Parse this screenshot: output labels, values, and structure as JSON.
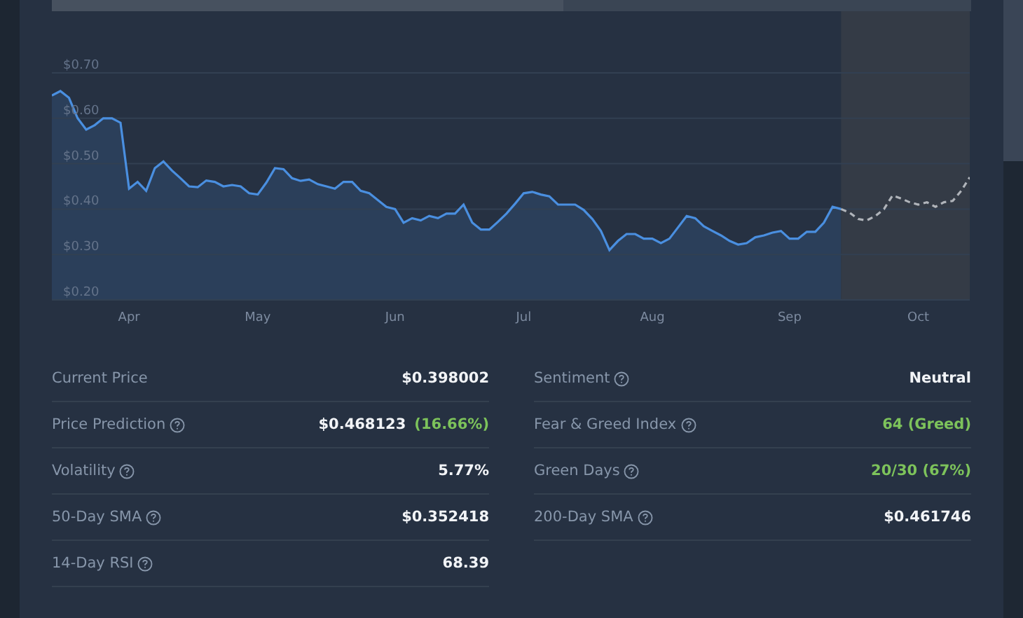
{
  "range_navigator": {
    "level": 0.557
  },
  "chart": {
    "chart_data": {
      "type": "area",
      "ylim": [
        0.2,
        0.7
      ],
      "grid": true,
      "yticks": [
        {
          "value": 0.2,
          "label": "$0.20"
        },
        {
          "value": 0.3,
          "label": "$0.30"
        },
        {
          "value": 0.4,
          "label": "$0.40"
        },
        {
          "value": 0.5,
          "label": "$0.50"
        },
        {
          "value": 0.6,
          "label": "$0.60"
        },
        {
          "value": 0.7,
          "label": "$0.70"
        }
      ],
      "categories": [
        null,
        null,
        null,
        null,
        null,
        null,
        null,
        null,
        null,
        "Apr",
        null,
        null,
        null,
        null,
        null,
        null,
        null,
        null,
        null,
        null,
        null,
        null,
        null,
        null,
        "May",
        null,
        null,
        null,
        null,
        null,
        null,
        null,
        null,
        null,
        null,
        null,
        null,
        null,
        null,
        null,
        "Jun",
        null,
        null,
        null,
        null,
        null,
        null,
        null,
        null,
        null,
        null,
        null,
        null,
        null,
        null,
        "Jul",
        null,
        null,
        null,
        null,
        null,
        null,
        null,
        null,
        null,
        null,
        null,
        null,
        null,
        null,
        "Aug",
        null,
        null,
        null,
        null,
        null,
        null,
        null,
        null,
        null,
        null,
        null,
        null,
        null,
        null,
        null,
        "Sep",
        null,
        null,
        null,
        null,
        null,
        null,
        null,
        null,
        null,
        null,
        null,
        null,
        null,
        null,
        "Oct",
        null,
        null,
        null,
        null,
        null,
        null
      ],
      "series": [
        {
          "color": "#4a8fe0",
          "values": [
            0.65,
            0.66,
            0.645,
            0.6,
            0.575,
            0.585,
            0.6,
            0.6,
            0.59,
            0.445,
            0.46,
            0.44,
            0.49,
            0.505,
            0.485,
            0.468,
            0.45,
            0.448,
            0.463,
            0.46,
            0.45,
            0.453,
            0.45,
            0.435,
            0.432,
            0.458,
            0.49,
            0.488,
            0.468,
            0.462,
            0.465,
            0.455,
            0.45,
            0.445,
            0.46,
            0.46,
            0.44,
            0.435,
            0.42,
            0.405,
            0.4,
            0.37,
            0.38,
            0.375,
            0.385,
            0.38,
            0.39,
            0.39,
            0.41,
            0.37,
            0.355,
            0.355,
            0.372,
            0.39,
            0.412,
            0.435,
            0.438,
            0.432,
            0.428,
            0.41,
            0.41,
            0.41,
            0.398,
            0.378,
            0.352,
            0.31,
            0.33,
            0.345,
            0.345,
            0.335,
            0.335,
            0.325,
            0.335,
            0.36,
            0.385,
            0.38,
            0.362,
            0.352,
            0.342,
            0.33,
            0.322,
            0.325,
            0.338,
            0.342,
            0.348,
            0.352,
            0.335,
            0.335,
            0.35,
            0.35,
            0.37,
            0.405,
            0.4,
            null,
            null,
            null,
            null,
            null,
            null,
            null,
            null,
            null,
            null,
            null,
            null,
            null,
            null,
            null
          ]
        },
        {
          "type": "line",
          "line_style": "dashed",
          "color": "#b0b4ba",
          "values": [
            null,
            null,
            null,
            null,
            null,
            null,
            null,
            null,
            null,
            null,
            null,
            null,
            null,
            null,
            null,
            null,
            null,
            null,
            null,
            null,
            null,
            null,
            null,
            null,
            null,
            null,
            null,
            null,
            null,
            null,
            null,
            null,
            null,
            null,
            null,
            null,
            null,
            null,
            null,
            null,
            null,
            null,
            null,
            null,
            null,
            null,
            null,
            null,
            null,
            null,
            null,
            null,
            null,
            null,
            null,
            null,
            null,
            null,
            null,
            null,
            null,
            null,
            null,
            null,
            null,
            null,
            null,
            null,
            null,
            null,
            null,
            null,
            null,
            null,
            null,
            null,
            null,
            null,
            null,
            null,
            null,
            null,
            null,
            null,
            null,
            null,
            null,
            null,
            null,
            null,
            null,
            null,
            0.4,
            0.392,
            0.378,
            0.375,
            0.385,
            0.4,
            0.43,
            0.423,
            0.415,
            0.41,
            0.415,
            0.405,
            0.415,
            0.418,
            0.44,
            0.47
          ]
        }
      ]
    }
  },
  "stats": [
    [
      {
        "label": "Current Price",
        "help": false,
        "value": [
          {
            "text": "$0.398002",
            "positive": false
          }
        ]
      },
      {
        "label": "Price Prediction",
        "help": true,
        "value": [
          {
            "text": "$0.468123",
            "positive": false
          },
          {
            "text": "(16.66%)",
            "positive": true
          }
        ]
      },
      {
        "label": "Volatility",
        "help": true,
        "value": [
          {
            "text": "5.77%",
            "positive": false
          }
        ]
      },
      {
        "label": "50-Day SMA",
        "help": true,
        "value": [
          {
            "text": "$0.352418",
            "positive": false
          }
        ]
      },
      {
        "label": "14-Day RSI",
        "help": true,
        "value": [
          {
            "text": "68.39",
            "positive": false
          }
        ]
      }
    ],
    [
      {
        "label": "Sentiment",
        "help": true,
        "value": [
          {
            "text": "Neutral",
            "positive": false
          }
        ]
      },
      {
        "label": "Fear & Greed Index",
        "help": true,
        "value": [
          {
            "text": "64 (Greed)",
            "positive": true
          }
        ]
      },
      {
        "label": "Green Days",
        "help": true,
        "value": [
          {
            "text": "20/30 (67%)",
            "positive": true
          }
        ]
      },
      {
        "label": "200-Day SMA",
        "help": true,
        "value": [
          {
            "text": "$0.461746",
            "positive": false
          }
        ]
      }
    ]
  ]
}
